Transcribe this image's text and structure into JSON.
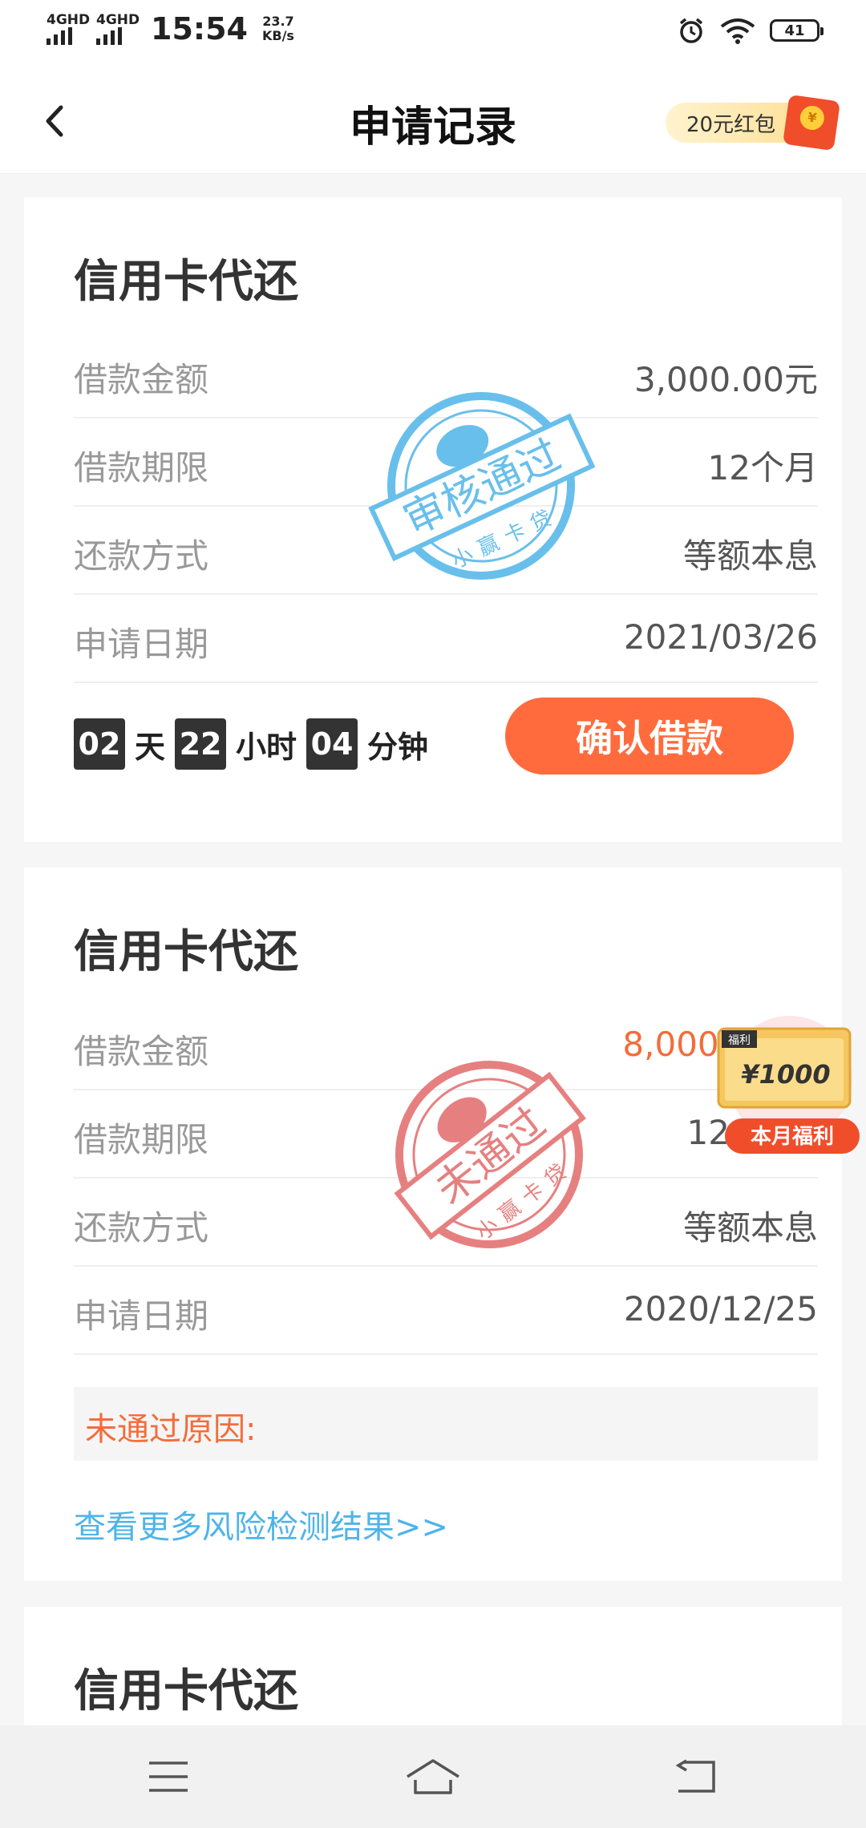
{
  "status": {
    "network1": "4GHD",
    "network2": "4GHD",
    "time": "15:54",
    "speed_value": "23.7",
    "speed_unit": "KB/s",
    "battery": "41"
  },
  "header": {
    "title": "申请记录",
    "redpack_label": "20元红包"
  },
  "cards": [
    {
      "title": "信用卡代还",
      "rows": [
        {
          "label": "借款金额",
          "value": "3,000.00元"
        },
        {
          "label": "借款期限",
          "value": "12个月"
        },
        {
          "label": "还款方式",
          "value": "等额本息"
        },
        {
          "label": "申请日期",
          "value": "2021/03/26"
        }
      ],
      "countdown": {
        "days": "02",
        "days_unit": "天",
        "hours": "22",
        "hours_unit": "小时",
        "minutes": "04",
        "minutes_unit": "分钟"
      },
      "button": "确认借款",
      "stamp": {
        "text": "审核通过",
        "brand": "小赢卡贷",
        "color": "#4fb4e8"
      }
    },
    {
      "title": "信用卡代还",
      "rows": [
        {
          "label": "借款金额",
          "value": "8,000."
        },
        {
          "label": "借款期限",
          "value": "12"
        },
        {
          "label": "还款方式",
          "value": "等额本息"
        },
        {
          "label": "申请日期",
          "value": "2020/12/25"
        }
      ],
      "reason_label": "未通过原因:",
      "more_link": "查看更多风险检测结果>>",
      "stamp": {
        "text": "未通过",
        "brand": "小赢卡贷",
        "color": "#e26a6a"
      }
    },
    {
      "title": "信用卡代还"
    }
  ],
  "welfare": {
    "tag": "福利",
    "amount": "¥1000",
    "label": "本月福利"
  }
}
